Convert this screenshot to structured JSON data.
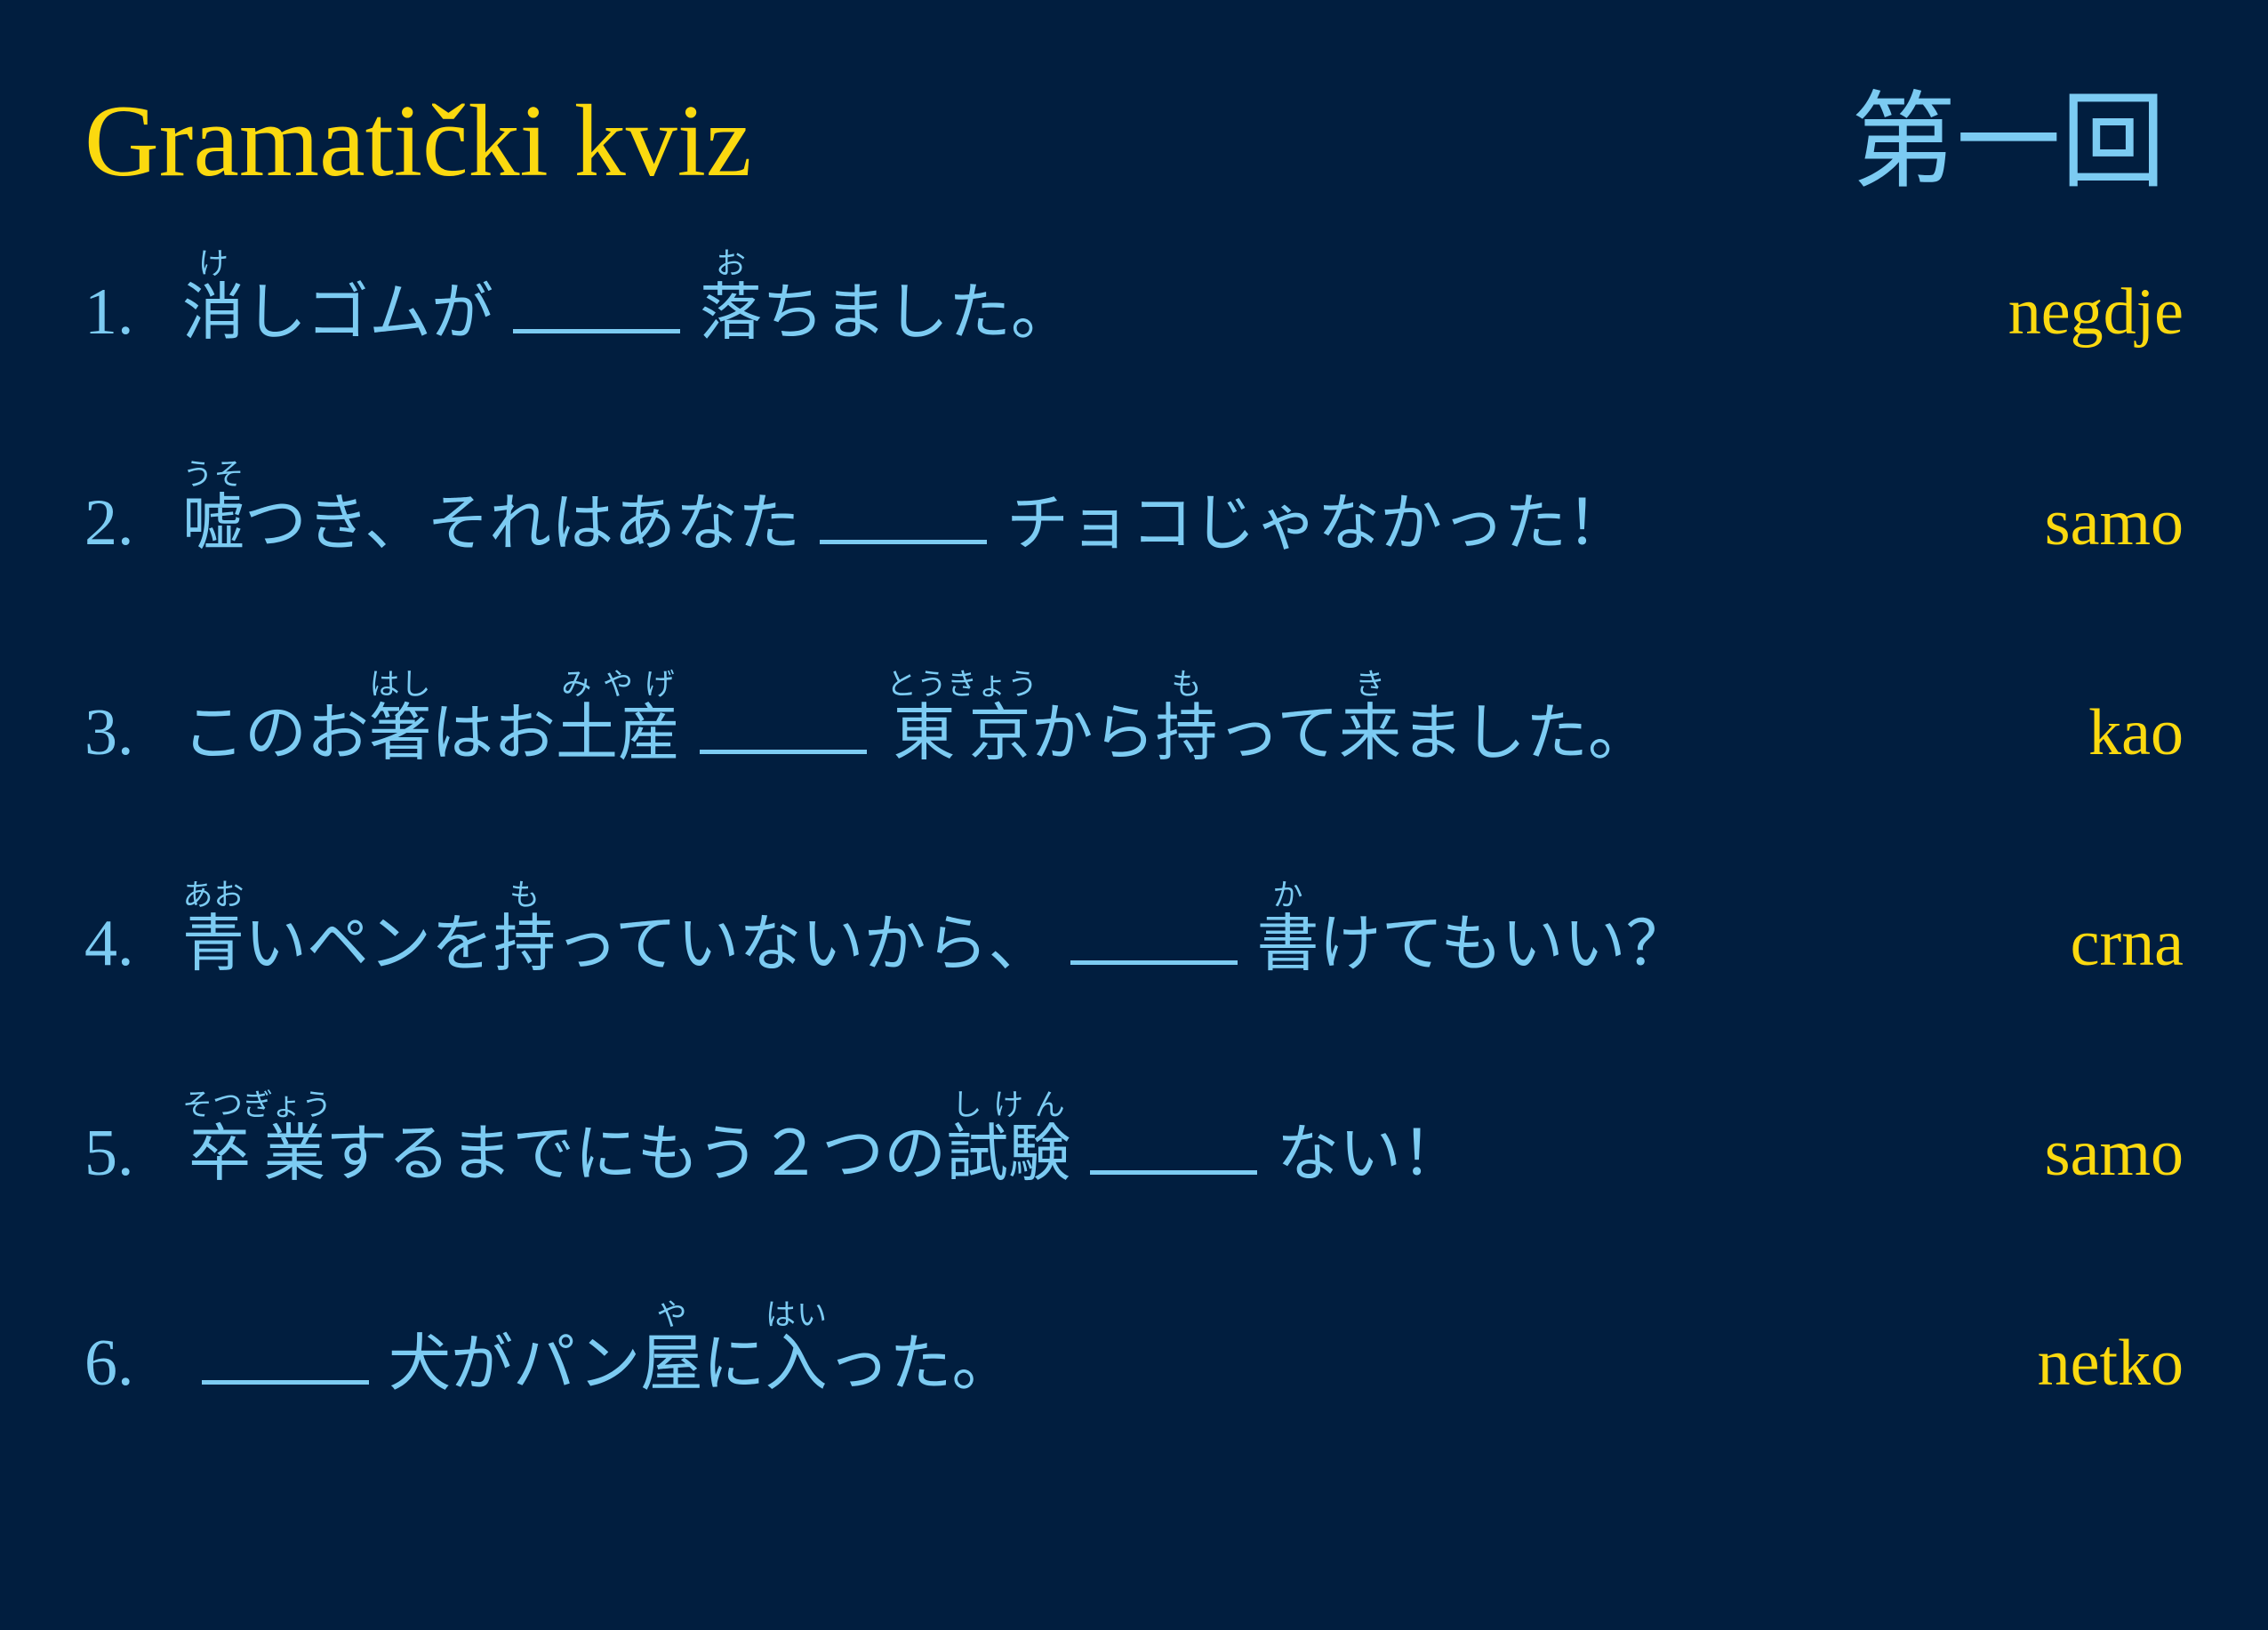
{
  "title": "Gramatički kviz",
  "chapter": "第一回",
  "colors": {
    "background": "#011e3f",
    "yellow": "#fbd90f",
    "blue": "#7ccbf2"
  },
  "questions": [
    {
      "number": "1.",
      "answer": "negdje",
      "segments": [
        {
          "base": "消",
          "rt": "け"
        },
        {
          "text": "しゴムが"
        },
        {
          "blank": true
        },
        {
          "base": "落",
          "rt": "お"
        },
        {
          "text": "ちました。"
        }
      ]
    },
    {
      "number": "2.",
      "answer": "samo",
      "segments": [
        {
          "base": "嘘",
          "rt": "うそ"
        },
        {
          "text": "つき、それはあなた"
        },
        {
          "blank": true
        },
        {
          "text": "チョコじゃなかった！"
        }
      ]
    },
    {
      "number": "3.",
      "answer": "kao",
      "segments": [
        {
          "text": "このお"
        },
        {
          "base": "箸",
          "rt": "はし"
        },
        {
          "text": "はお"
        },
        {
          "base": "土産",
          "rt": "みやげ"
        },
        {
          "blank": true
        },
        {
          "base": "東京",
          "rt": "とうきょう"
        },
        {
          "text": "から"
        },
        {
          "base": "持",
          "rt": "も"
        },
        {
          "text": "って"
        },
        {
          "base": "来",
          "rt": "き"
        },
        {
          "text": "ました。"
        }
      ]
    },
    {
      "number": "4.",
      "answer": "crna",
      "segments": [
        {
          "base": "青",
          "rt": "あお"
        },
        {
          "text": "いペンを"
        },
        {
          "base": "持",
          "rt": "も"
        },
        {
          "text": "っていないから、"
        },
        {
          "blank": true
        },
        {
          "base": "書",
          "rt": "か"
        },
        {
          "text": "けてもいい？"
        }
      ]
    },
    {
      "number": "5.",
      "answer": "samo",
      "segments": [
        {
          "base": "卒業",
          "rt": "そつぎょう"
        },
        {
          "text": "するまでにもう２つの"
        },
        {
          "base": "試験",
          "rt": "しけん"
        },
        {
          "blank": true
        },
        {
          "text": "ない！"
        }
      ]
    },
    {
      "number": "6.",
      "answer": "netko",
      "segments": [
        {
          "blank": true
        },
        {
          "text": "犬がパン"
        },
        {
          "base": "屋",
          "rt": "や"
        },
        {
          "text": "に"
        },
        {
          "base": "入",
          "rt": "はい"
        },
        {
          "text": "った。"
        }
      ]
    }
  ]
}
